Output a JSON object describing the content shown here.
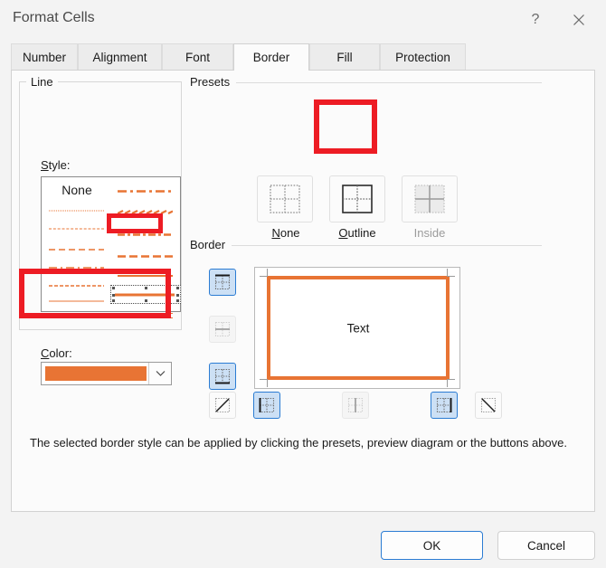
{
  "window": {
    "title": "Format Cells",
    "help_button": "?",
    "close_icon": "close-icon"
  },
  "tabs": [
    {
      "label": "Number",
      "active": false
    },
    {
      "label": "Alignment",
      "active": false
    },
    {
      "label": "Font",
      "active": false
    },
    {
      "label": "Border",
      "active": true
    },
    {
      "label": "Fill",
      "active": false
    },
    {
      "label": "Protection",
      "active": false
    }
  ],
  "line_group": {
    "title": "Line",
    "style_label": "Style:",
    "none_label": "None",
    "color_label": "Color:",
    "color_value": "#E87434",
    "dropdown_icon": "chevron-down-icon",
    "selected_style": "thick-solid",
    "styles_left": [
      "none",
      "fine-dotted",
      "dotted",
      "dashed",
      "dash-dot",
      "dash-dot-dot",
      "thin-solid"
    ],
    "styles_right": [
      "dash-dot-long",
      "slant-dash",
      "dash-dot-medium",
      "long-dash",
      "medium-solid",
      "thick-solid",
      "double"
    ]
  },
  "presets": {
    "title": "Presets",
    "items": [
      {
        "label": "None",
        "icon": "preset-none-icon",
        "selected": false,
        "disabled": false
      },
      {
        "label": "Outline",
        "icon": "preset-outline-icon",
        "selected": true,
        "disabled": false
      },
      {
        "label": "Inside",
        "icon": "preset-inside-icon",
        "selected": false,
        "disabled": true
      }
    ]
  },
  "border": {
    "title": "Border",
    "preview_text": "Text",
    "preview_border_color": "#E87434",
    "side_buttons": [
      {
        "name": "border-top-button",
        "icon": "border-top-icon",
        "active": true,
        "disabled": false
      },
      {
        "name": "border-inside-horizontal-button",
        "icon": "border-inside-horizontal-icon",
        "active": false,
        "disabled": true
      },
      {
        "name": "border-bottom-button",
        "icon": "border-bottom-icon",
        "active": true,
        "disabled": false
      }
    ],
    "bottom_buttons": [
      {
        "name": "border-diagonal-up-button",
        "icon": "border-diagonal-up-icon",
        "active": false,
        "disabled": false
      },
      {
        "name": "border-left-button",
        "icon": "border-left-icon",
        "active": true,
        "disabled": false
      },
      {
        "name": "border-inside-vertical-button",
        "icon": "border-inside-vertical-icon",
        "active": false,
        "disabled": true
      },
      {
        "name": "border-right-button",
        "icon": "border-right-icon",
        "active": true,
        "disabled": false
      },
      {
        "name": "border-diagonal-down-button",
        "icon": "border-diagonal-down-icon",
        "active": false,
        "disabled": false
      }
    ]
  },
  "help_text": "The selected border style can be applied by clicking the presets, preview diagram or the buttons above.",
  "footer": {
    "ok_label": "OK",
    "cancel_label": "Cancel"
  },
  "annotations": {
    "color": "#ED1C24",
    "boxes": [
      "style-thick-solid",
      "color-picker",
      "preset-outline"
    ]
  }
}
